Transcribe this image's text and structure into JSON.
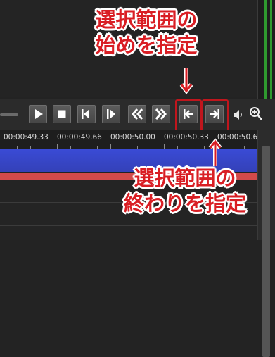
{
  "annotations": {
    "start_line1": "選択範囲の",
    "start_line2": "始めを指定",
    "end_line1": "選択範囲の",
    "end_line2": "終わりを指定"
  },
  "transport": {
    "buttons": [
      {
        "name": "play-button",
        "icon": "play-icon"
      },
      {
        "name": "stop-button",
        "icon": "stop-icon"
      },
      {
        "name": "previous-frame-button",
        "icon": "step-back-icon"
      },
      {
        "name": "next-frame-button",
        "icon": "step-forward-icon"
      },
      {
        "name": "rewind-button",
        "icon": "double-chevron-left-icon"
      },
      {
        "name": "fast-forward-button",
        "icon": "double-chevron-right-icon"
      },
      {
        "name": "set-selection-start-button",
        "icon": "mark-in-icon"
      },
      {
        "name": "set-selection-end-button",
        "icon": "mark-out-icon"
      }
    ],
    "volume_icon": "speaker-icon",
    "zoom_icon": "zoom-in-icon"
  },
  "timeline": {
    "timecodes": [
      "00:00:49.33",
      "00:00:49.66",
      "00:00:50.00",
      "00:00:50.33",
      "00:00:50.6"
    ]
  },
  "colors": {
    "highlight": "#d91e24",
    "video_track": "#3a4bd6",
    "audio_track": "#d24a4a",
    "meter": "#2f9a2f"
  }
}
